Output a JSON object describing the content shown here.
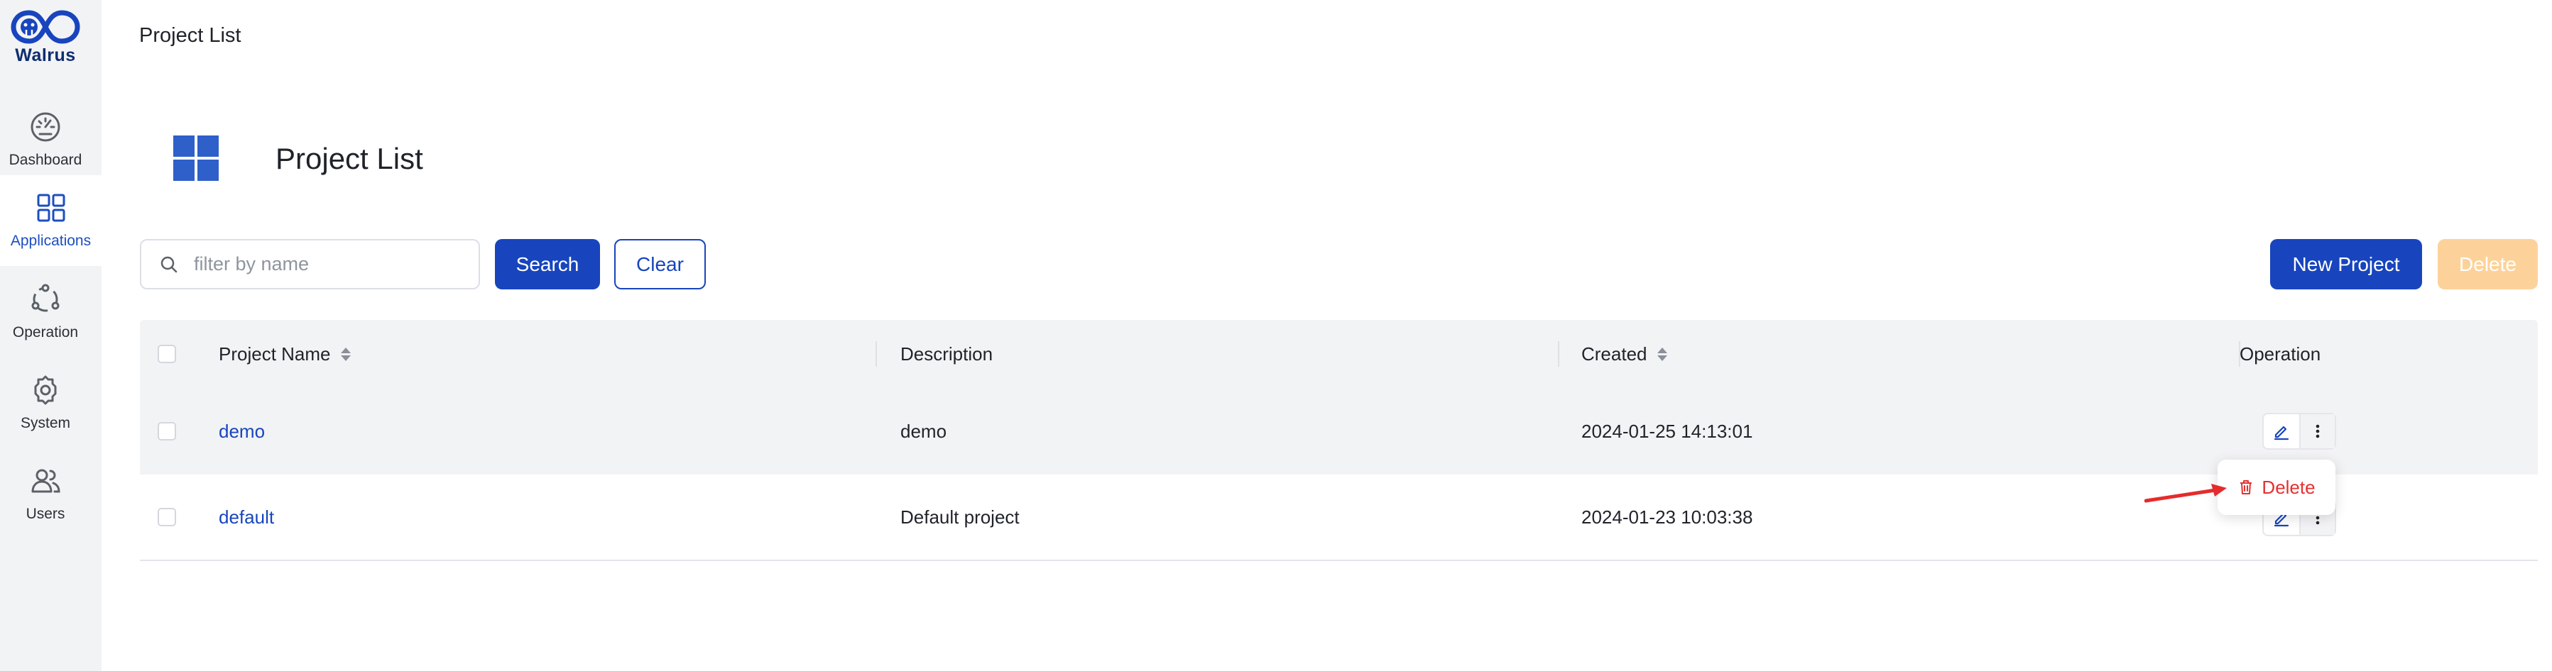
{
  "app": {
    "logo_text": "Walrus",
    "accent": "#1845be",
    "danger": "#e5302f"
  },
  "sidebar": {
    "items": [
      {
        "label": "Dashboard",
        "icon": "dashboard-icon",
        "active": false
      },
      {
        "label": "Applications",
        "icon": "applications-icon",
        "active": true
      },
      {
        "label": "Operation",
        "icon": "operation-icon",
        "active": false
      },
      {
        "label": "System",
        "icon": "gear-icon",
        "active": false
      },
      {
        "label": "Users",
        "icon": "users-icon",
        "active": false
      }
    ]
  },
  "header": {
    "breadcrumb": "Project List",
    "title": "Project List",
    "title_icon": "grid-icon"
  },
  "toolbar": {
    "search_placeholder": "filter by name",
    "search_value": "",
    "search_label": "Search",
    "clear_label": "Clear",
    "new_label": "New Project",
    "delete_label": "Delete"
  },
  "table": {
    "columns": [
      "Project Name",
      "Description",
      "Created",
      "Operation"
    ],
    "rows": [
      {
        "name": "demo",
        "description": "demo",
        "created": "2024-01-25 14:13:01"
      },
      {
        "name": "default",
        "description": "Default project",
        "created": "2024-01-23 10:03:38"
      }
    ]
  },
  "dropdown": {
    "delete_label": "Delete",
    "icon": "trash-icon"
  }
}
